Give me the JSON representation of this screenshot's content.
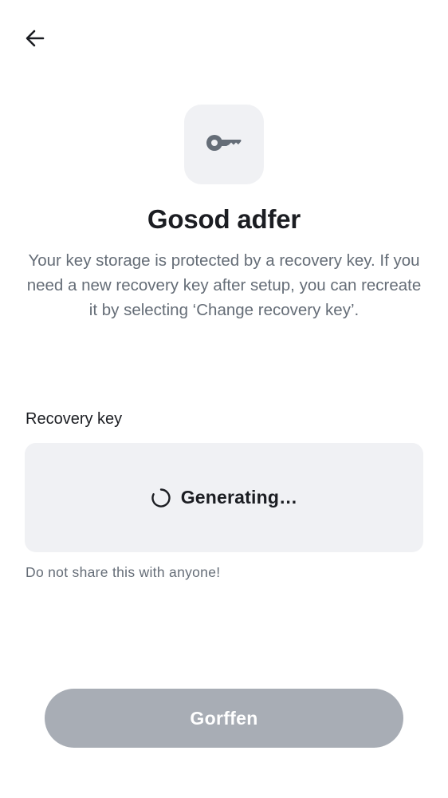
{
  "header": {
    "back_icon": "arrow-left-icon"
  },
  "hero": {
    "icon": "key-icon",
    "title": "Gosod adfer",
    "description": "Your key storage is protected by a recovery key. If you need a new recovery key after setup, you can recreate it by selecting ‘Change recovery key’."
  },
  "recovery_key": {
    "label": "Recovery key",
    "status_icon": "spinner-icon",
    "status_text": "Generating…",
    "hint": "Do not share this with anyone!"
  },
  "footer": {
    "continue_label": "Gorffen",
    "continue_enabled": false
  },
  "colors": {
    "tile_background": "#f0f1f4",
    "secondary_text": "#656d77",
    "primary_text": "#1b1d22",
    "disabled_button": "#a8adb5"
  }
}
